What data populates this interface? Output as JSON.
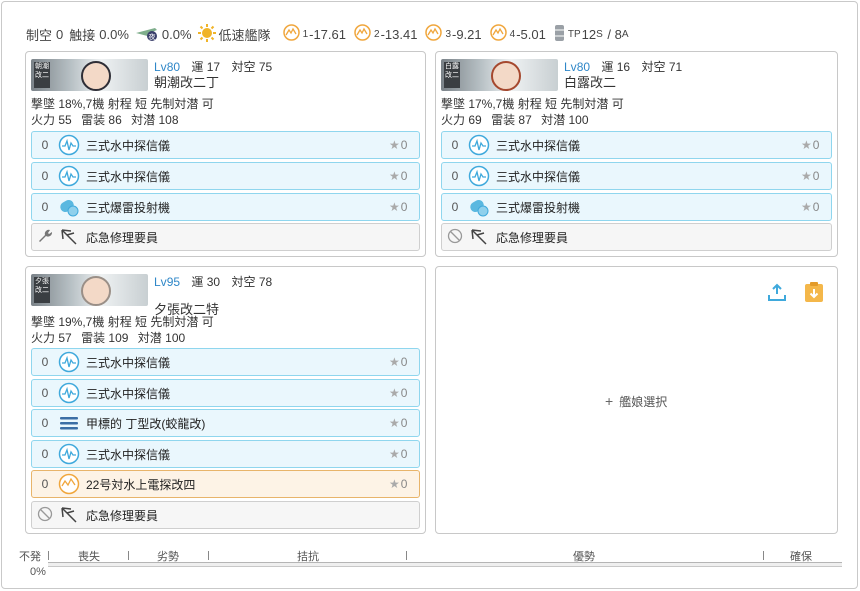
{
  "topbar": {
    "air_label": "制空",
    "air_value": "0",
    "contact_label": "触接",
    "contact_value": "0.0%",
    "recon_value": "0.0%",
    "speed": "低速艦隊",
    "los": [
      {
        "idx": "1",
        "value": "-17.61"
      },
      {
        "idx": "2",
        "value": "-13.41"
      },
      {
        "idx": "3",
        "value": "-9.21"
      },
      {
        "idx": "4",
        "value": "-5.01"
      }
    ],
    "tp_label": "TP",
    "tp_s": "12",
    "tp_s_sub": "S",
    "tp_sep": " / ",
    "tp_a": "8",
    "tp_a_sub": "A"
  },
  "ships": [
    {
      "lv_label": "Lv",
      "lv": "80",
      "luck_label": "運",
      "luck": "17",
      "aa_label": "対空",
      "aa": "75",
      "name": "朝潮改二丁",
      "line1": "撃墜 18%,7機  射程 短  先制対潜 可",
      "line2_fp": "火力",
      "fp": "55",
      "tp_lbl": "雷装",
      "tp": "86",
      "asw_lbl": "対潜",
      "asw": "108",
      "slots": [
        {
          "count": "0",
          "name": "三式水中探信儀",
          "stars": "0",
          "icon": "sonar-icon"
        },
        {
          "count": "0",
          "name": "三式水中探信儀",
          "stars": "0",
          "icon": "sonar-icon"
        },
        {
          "count": "0",
          "name": "三式爆雷投射機",
          "stars": "0",
          "icon": "depth-charge-icon"
        }
      ],
      "ex": {
        "name": "応急修理要員",
        "icon": "wrench-icon"
      }
    },
    {
      "lv_label": "Lv",
      "lv": "80",
      "luck_label": "運",
      "luck": "16",
      "aa_label": "対空",
      "aa": "71",
      "name": "白露改二",
      "line1": "撃墜 17%,7機  射程 短  先制対潜 可",
      "line2_fp": "火力",
      "fp": "69",
      "tp_lbl": "雷装",
      "tp": "87",
      "asw_lbl": "対潜",
      "asw": "100",
      "slots": [
        {
          "count": "0",
          "name": "三式水中探信儀",
          "stars": "0",
          "icon": "sonar-icon"
        },
        {
          "count": "0",
          "name": "三式水中探信儀",
          "stars": "0",
          "icon": "sonar-icon"
        },
        {
          "count": "0",
          "name": "三式爆雷投射機",
          "stars": "0",
          "icon": "depth-charge-icon"
        }
      ],
      "ex": {
        "name": "応急修理要員",
        "icon": "no-entry-icon"
      }
    },
    {
      "lv_label": "Lv",
      "lv": "95",
      "luck_label": "運",
      "luck": "30",
      "aa_label": "対空",
      "aa": "78",
      "name": "夕張改二特",
      "line1": "撃墜 19%,7機  射程 短  先制対潜 可",
      "line2_fp": "火力",
      "fp": "57",
      "tp_lbl": "雷装",
      "tp": "109",
      "asw_lbl": "対潜",
      "asw": "100",
      "slots": [
        {
          "count": "0",
          "name": "三式水中探信儀",
          "stars": "0",
          "icon": "sonar-icon"
        },
        {
          "count": "0",
          "name": "三式水中探信儀",
          "stars": "0",
          "icon": "sonar-icon"
        },
        {
          "count": "0",
          "name": "甲標的 丁型改(蛟龍改)",
          "stars": "0",
          "icon": "midget-sub-icon"
        },
        {
          "count": "0",
          "name": "三式水中探信儀",
          "stars": "0",
          "icon": "sonar-icon"
        },
        {
          "count": "0",
          "name": "22号対水上電探改四",
          "stars": "0",
          "icon": "radar-icon"
        }
      ],
      "ex": {
        "name": "応急修理要員",
        "icon": "no-entry-icon"
      }
    }
  ],
  "empty_slot": {
    "label": "艦娘選択"
  },
  "result": {
    "left_label": "不発",
    "left_value": "0%",
    "segments": [
      "喪失",
      "劣勢",
      "拮抗",
      "優勢",
      "確保"
    ]
  },
  "colors": {
    "level": "#2f87c8",
    "slot_border": "#8fd6ee",
    "slot_bg": "#eaf7fd",
    "radar_border": "#e8b46a",
    "accent_icon": "#3fa9dc",
    "paste_icon": "#f4b74a"
  }
}
